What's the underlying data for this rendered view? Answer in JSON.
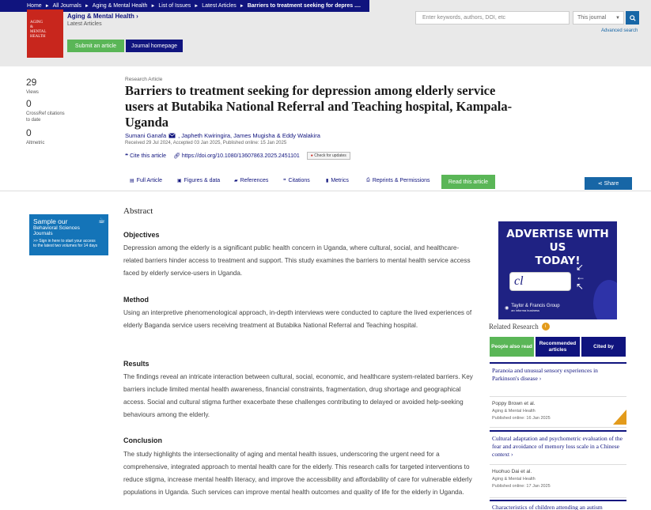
{
  "breadcrumb": [
    "Home",
    "All Journals",
    "Aging & Mental Health",
    "List of Issues",
    "Latest Articles",
    "Barriers to treatment seeking for depres ...."
  ],
  "journal": {
    "title": "Aging & Mental Health",
    "title_arrow": "›",
    "section": "Latest Articles",
    "cover_text": [
      "AGING",
      "&",
      "MENTAL",
      "HEALTH"
    ],
    "submit_label": "Submit an article",
    "homepage_label": "Journal homepage"
  },
  "search": {
    "placeholder": "Enter keywords, authors, DOI, etc",
    "scope": "This journal",
    "advanced": "Advanced search"
  },
  "metrics": [
    {
      "value": "29",
      "label": "Views"
    },
    {
      "value": "0",
      "label": "CrossRef citations to date"
    },
    {
      "value": "0",
      "label": "Altmetric"
    }
  ],
  "article": {
    "type": "Research Article",
    "title": "Barriers to treatment seeking for depression among elderly service users at Butabika National Referral and Teaching hospital, Kampala- Uganda",
    "author_primary": "Sumani Ganafa",
    "authors_rest": ", Japheth Kwiringira, James Mugisha & Eddy Walakira",
    "dates": "Received 29 Jul 2024, Accepted 03 Jan 2025, Published online: 15 Jan 2025",
    "cite": "Cite this article",
    "doi": "https://doi.org/10.1080/13607863.2025.2451101",
    "check_updates": "Check for updates"
  },
  "tabs": [
    "Full Article",
    "Figures & data",
    "References",
    "Citations",
    "Metrics",
    "Reprints & Permissions"
  ],
  "read_article": "Read this article",
  "share": "Share",
  "promo": {
    "line1": "Sample our",
    "line2": "Behavioral Sciences",
    "line3": "Journals",
    "line4": ">> Sign in here to start your access",
    "line5": "to the latest two volumes for 14 days"
  },
  "abstract": {
    "heading": "Abstract",
    "sections": [
      {
        "heading": "Objectives",
        "text": "Depression among the elderly is a significant public health concern in Uganda, where cultural, social, and healthcare-related barriers hinder access to treatment and support. This study examines the barriers to mental health service access faced by elderly service-users in Uganda."
      },
      {
        "heading": "Method",
        "text": "Using an interpretive phenomenological approach, in-depth interviews were conducted to capture the lived experiences of elderly Baganda service users receiving treatment at Butabika National Referral and Teaching hospital."
      },
      {
        "heading": "Results",
        "text": "The findings reveal an intricate interaction between cultural, social, economic, and healthcare system-related barriers. Key barriers include limited mental health awareness, financial constraints, fragmentation, drug shortage and geographical access. Social and cultural stigma further exacerbate these challenges contributing to delayed or avoided help-seeking behaviours among the elderly."
      },
      {
        "heading": "Conclusion",
        "text": "The study highlights the intersectionality of aging and mental health issues, underscoring the urgent need for a comprehensive, integrated approach to mental health care for the elderly. This research calls for targeted interventions to reduce stigma, increase mental health literacy, and improve the accessibility and affordability of care for vulnerable elderly populations in Uganda. Such services can improve mental health outcomes and quality of life for the elderly in Uganda."
      }
    ]
  },
  "ad": {
    "line1": "ADVERTISE WITH US",
    "line2": "TODAY!",
    "cursor": "cl",
    "brand": "Taylor & Francis Group",
    "brand_sub": "an informa business"
  },
  "related": {
    "heading": "Related Research",
    "badge": "i",
    "tabs": [
      "People also read",
      "Recommended articles",
      "Cited by"
    ],
    "items": [
      {
        "title": "Paranoia and unusual sensory experiences in Parkinson's disease",
        "author": "Poppy Brown et al.",
        "journal": "Aging & Mental Health",
        "date": "Published online: 16 Jan 2025"
      },
      {
        "title": "Cultural adaptation and psychometric evaluation of the fear and avoidance of memory loss scale in a Chinese context",
        "author": "Huohuo Dai et al.",
        "journal": "Aging & Mental Health",
        "date": "Published online: 17 Jan 2025"
      },
      {
        "title": "Characteristics of children attending an autism"
      }
    ]
  },
  "colors": {
    "navy": "#10147e",
    "green": "#5ab657",
    "blue": "#1766a6",
    "orange": "#e39b1b"
  }
}
